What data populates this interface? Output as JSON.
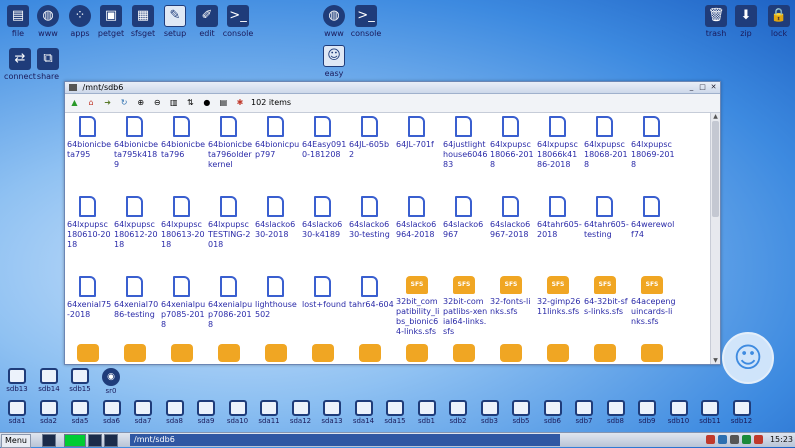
{
  "desktop": {
    "top_icons": [
      {
        "label": "file",
        "icon": "file-manager-icon"
      },
      {
        "label": "www",
        "icon": "globe-icon"
      },
      {
        "label": "apps",
        "icon": "apps-grid-icon"
      },
      {
        "label": "petget",
        "icon": "package-icon"
      },
      {
        "label": "sfsget",
        "icon": "sfs-package-icon"
      },
      {
        "label": "setup",
        "icon": "wrench-icon"
      },
      {
        "label": "edit",
        "icon": "edit-document-icon"
      },
      {
        "label": "console",
        "icon": "terminal-icon"
      },
      {
        "label": "www",
        "icon": "globe-icon"
      },
      {
        "label": "console",
        "icon": "terminal-icon"
      }
    ],
    "right_icons": [
      {
        "label": "trash",
        "icon": "trash-icon"
      },
      {
        "label": "zip",
        "icon": "archive-icon"
      },
      {
        "label": "lock",
        "icon": "lock-icon"
      }
    ],
    "row2_icons": [
      {
        "label": "connect",
        "icon": "network-icon"
      },
      {
        "label": "share",
        "icon": "share-icon"
      },
      {
        "label": "easy",
        "icon": "easy-logo-icon"
      }
    ]
  },
  "window": {
    "title": "/mnt/sdb6",
    "item_count": "102 items",
    "files": [
      "64bionicbeta795",
      "64bionicbeta795k4189",
      "64bionicbeta796",
      "64bionicbeta796olderkernel",
      "64bionicpup797",
      "64Easy0910-181208",
      "64JL-605b2",
      "64JL-701f",
      "64justlighthouse604683",
      "64lxpupsc18066-2018",
      "64lxpupsc18066k4186-2018",
      "64lxpupsc18068-2018",
      "64lxpupsc18069-2018",
      "64lxpupsc180610-2018",
      "64lxpupsc180612-2018",
      "64lxpupsc180613-2018",
      "64lxpupscTESTING-2018",
      "64slacko630-2018",
      "64slacko630-k4189",
      "64slacko630-testing",
      "64slacko6964-2018",
      "64slacko6967",
      "64slacko6967-2018",
      "64tahr605-2018",
      "64tahr605-testing",
      "64werewolf74",
      "64xenial75-2018",
      "64xenial7086-testing",
      "64xenialpup7085-2018",
      "64xenialpup7086-2018",
      "lighthouse502",
      "lost+found",
      "tahr64-604"
    ],
    "sfs_files": [
      "32bit_compatibility_libs_bionic64-links.sfs",
      "32bit-compatlibs-xenial64-links.sfs",
      "32-fonts-links.sfs",
      "32-gimp2611links.sfs",
      "64-32bit-sfs-links.sfs",
      "64acepenguincards-links.sfs"
    ]
  },
  "drives_row1": [
    "sdb13",
    "sdb14",
    "sdb15",
    "sr0"
  ],
  "drives_row2": [
    "sda1",
    "sda2",
    "sda5",
    "sda6",
    "sda7",
    "sda8",
    "sda9",
    "sda10",
    "sda11",
    "sda12",
    "sda13",
    "sda14",
    "sda15",
    "sdb1",
    "sdb2",
    "sdb3",
    "sdb5",
    "sdb6",
    "sdb7",
    "sdb8",
    "sdb9",
    "sdb10",
    "sdb11",
    "sdb12"
  ],
  "taskbar": {
    "menu_label": "Menu",
    "task_label": "/mnt/sdb6",
    "clock": "15:23"
  },
  "colors": {
    "accent": "#2f57a3",
    "link": "#2a2aa8",
    "sfs": "#f0a623"
  }
}
